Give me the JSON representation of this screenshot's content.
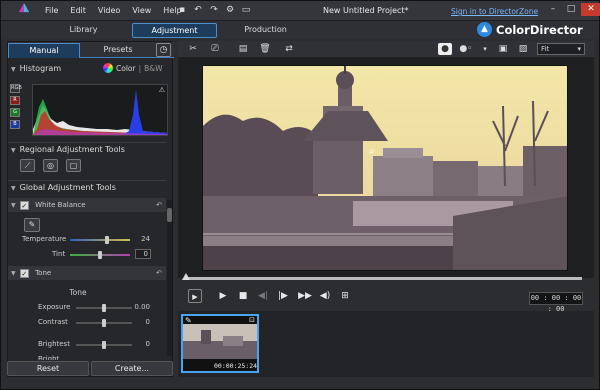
{
  "menu": [
    "File",
    "Edit",
    "Video",
    "View",
    "Help"
  ],
  "window": {
    "title": "New Untitled Project*",
    "sign_in": "Sign in to DirectorZone"
  },
  "tabs": {
    "library": "Library",
    "adjustment": "Adjustment",
    "production": "Production"
  },
  "brand": {
    "name": "ColorDirector"
  },
  "left": {
    "subtabs": {
      "manual": "Manual",
      "presets": "Presets"
    },
    "histogram": {
      "title": "Histogram",
      "color": "Color",
      "bw": "B&W",
      "channels": [
        "RGB",
        "R",
        "G",
        "B"
      ]
    },
    "regional": {
      "title": "Regional Adjustment Tools"
    },
    "global": {
      "title": "Global Adjustment Tools"
    },
    "white_balance": {
      "title": "White Balance",
      "temperature": {
        "label": "Temperature",
        "value": "24",
        "level": 0.62
      },
      "tint": {
        "label": "Tint",
        "value": "0",
        "level": 0.5
      }
    },
    "tone": {
      "title": "Tone",
      "subheading": "Tone",
      "exposure": {
        "label": "Exposure",
        "value": "0.00",
        "level": 0.5
      },
      "contrast": {
        "label": "Contrast",
        "value": "0",
        "level": 0.5
      },
      "brightest": {
        "label": "Brightest",
        "value": "0",
        "level": 0.5
      },
      "bright": {
        "label": "Bright"
      }
    },
    "buttons": {
      "reset": "Reset",
      "create": "Create..."
    }
  },
  "preview": {
    "fit": "Fit",
    "timecode": "00 : 00 : 00 : 00"
  },
  "timeline": {
    "clip_timecode": "00:00:25:24"
  }
}
